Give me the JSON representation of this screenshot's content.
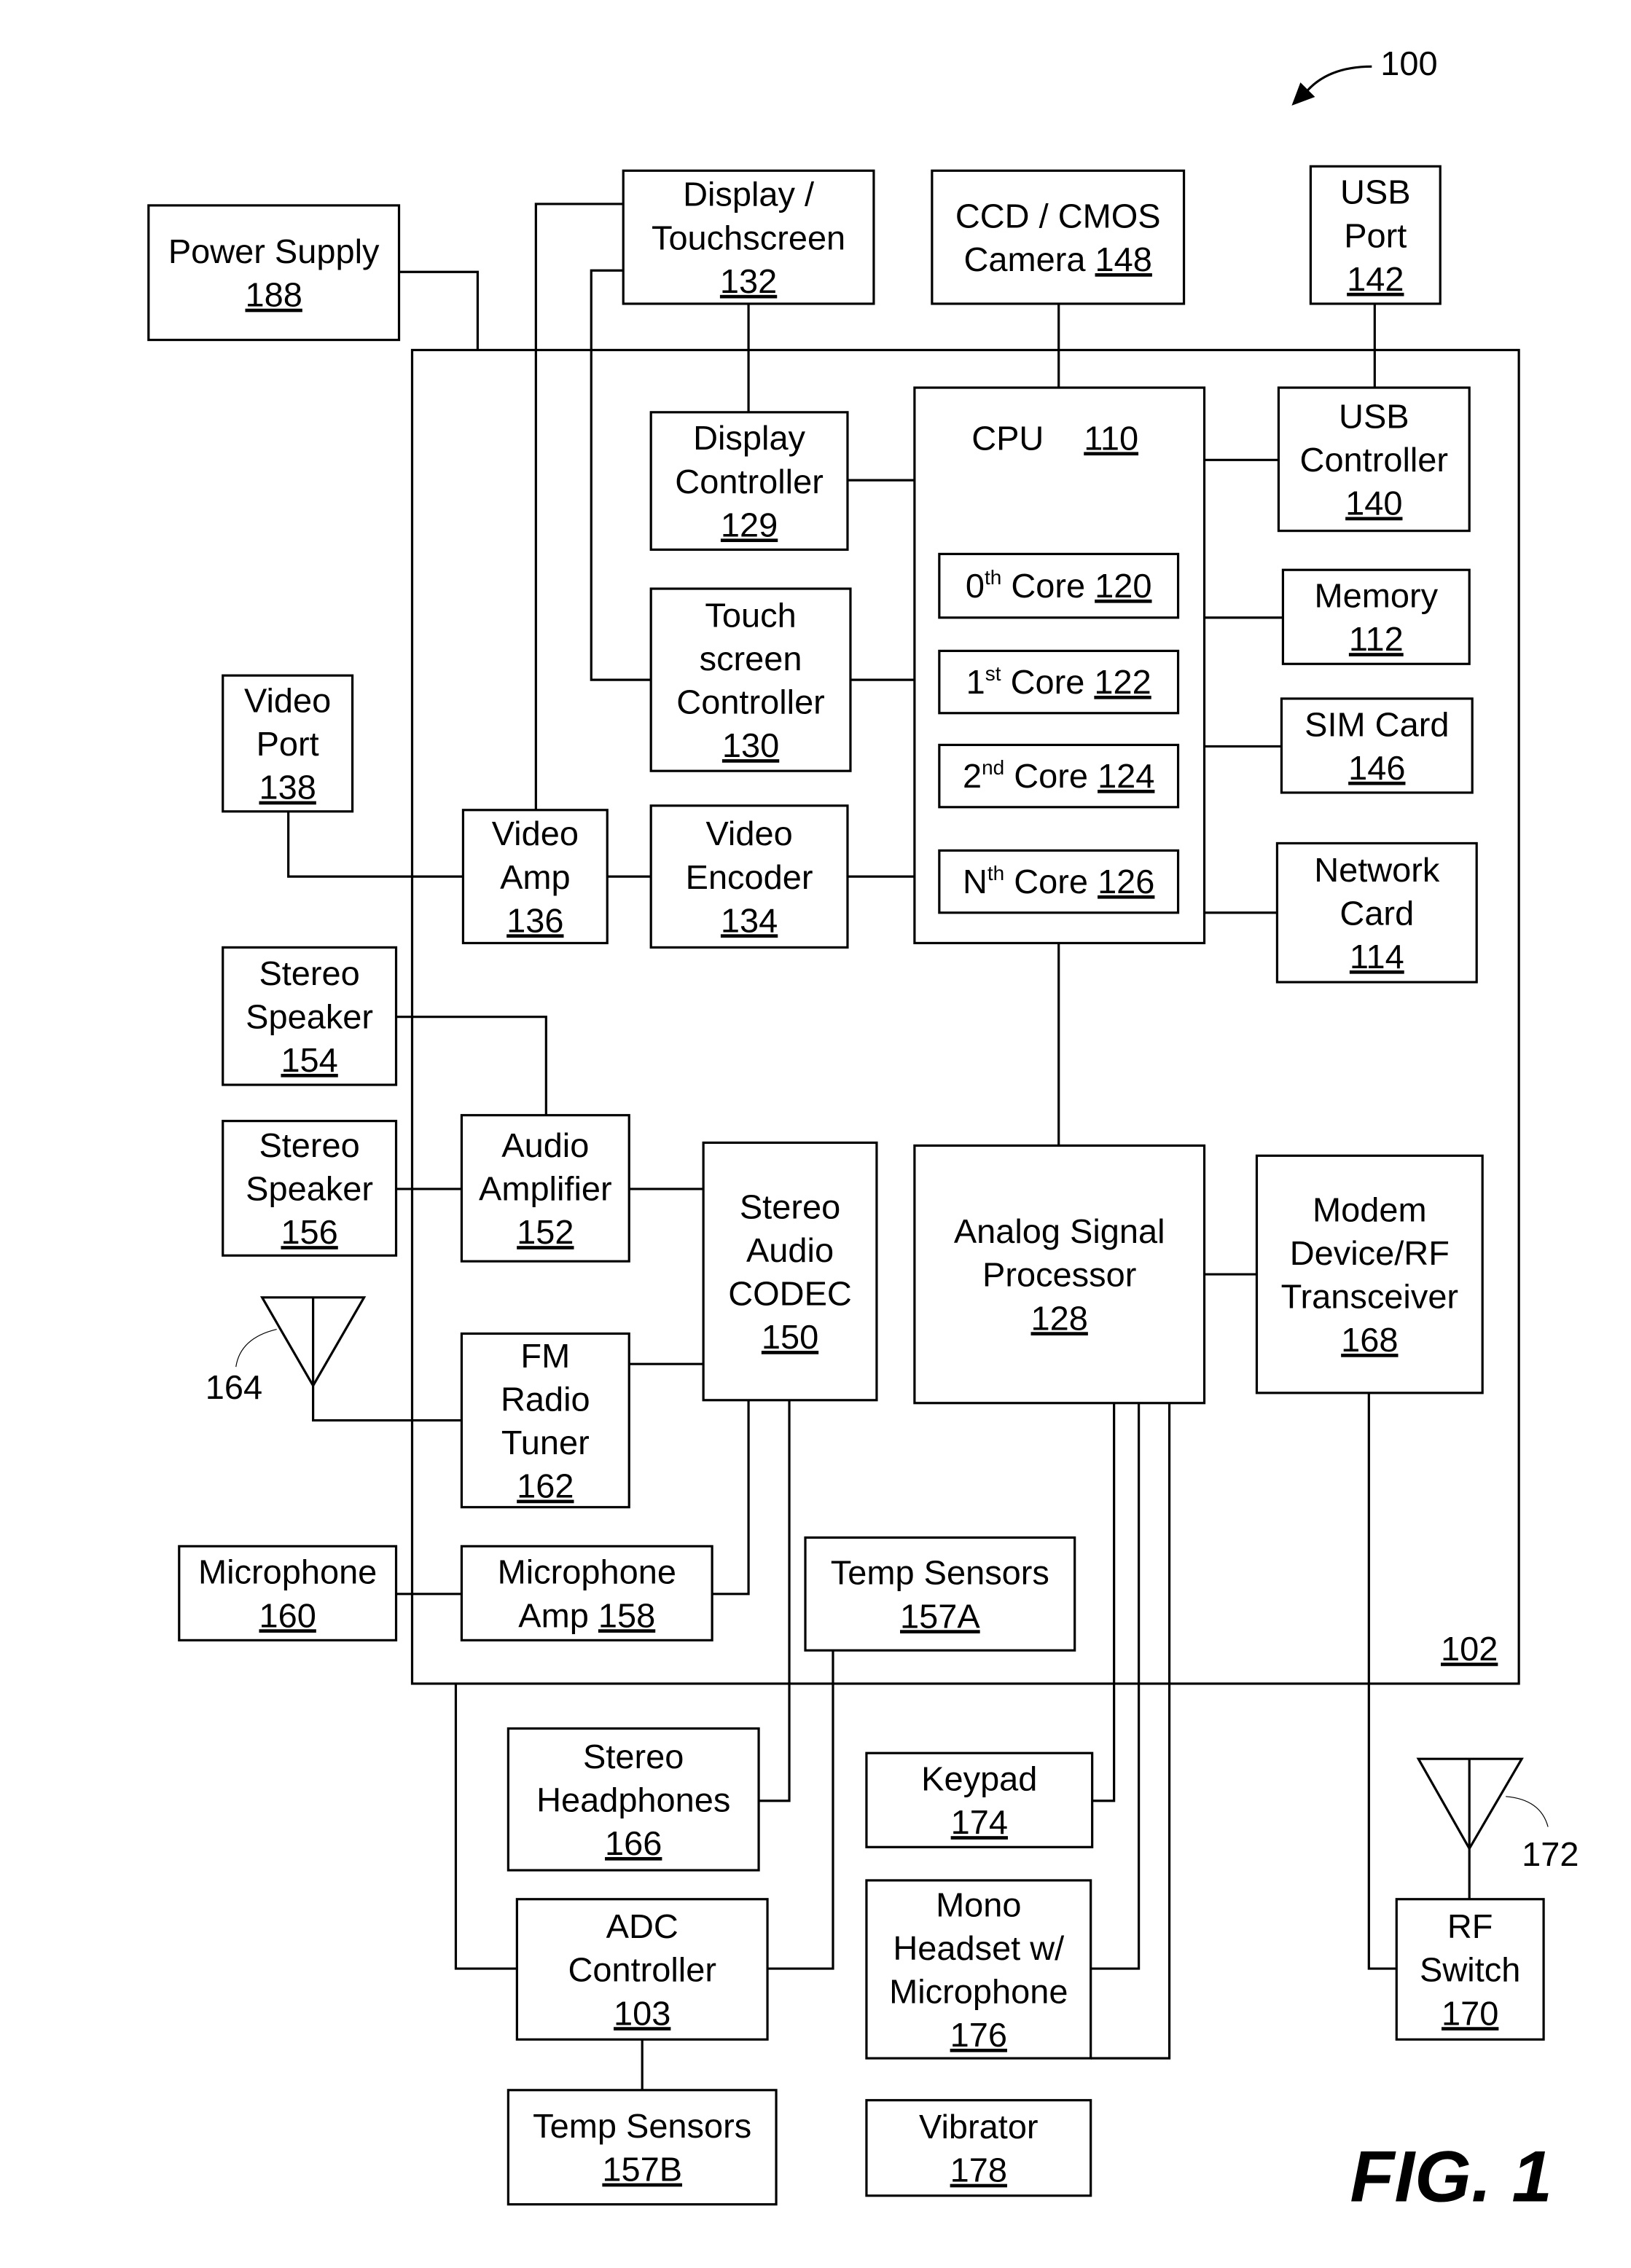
{
  "figure": {
    "label": "FIG.  1",
    "system_ref": "100",
    "chip_ref": "102"
  },
  "blocks": [
    {
      "id": "power-supply",
      "lines": [
        "Power Supply"
      ],
      "ref": "188"
    },
    {
      "id": "display-touchscreen",
      "lines": [
        "Display /",
        "Touchscreen"
      ],
      "ref": "132"
    },
    {
      "id": "camera",
      "lines": [
        "CCD / CMOS"
      ],
      "inline_prefix": "Camera",
      "ref": "148"
    },
    {
      "id": "usb-port",
      "lines": [
        "USB",
        "Port"
      ],
      "ref": "142"
    },
    {
      "id": "display-controller",
      "lines": [
        "Display",
        "Controller"
      ],
      "ref": "129"
    },
    {
      "id": "cpu",
      "inline_prefix": "CPU",
      "ref": "110"
    },
    {
      "id": "usb-controller",
      "lines": [
        "USB",
        "Controller"
      ],
      "ref": "140"
    },
    {
      "id": "core-0",
      "base": "0",
      "sup": "th",
      "suffix": "Core",
      "ref": "120"
    },
    {
      "id": "core-1",
      "base": "1",
      "sup": "st",
      "suffix": "Core",
      "ref": "122"
    },
    {
      "id": "core-2",
      "base": "2",
      "sup": "nd",
      "suffix": "Core",
      "ref": "124"
    },
    {
      "id": "core-n",
      "base": "N",
      "sup": "th",
      "suffix": "Core",
      "ref": "126"
    },
    {
      "id": "memory",
      "lines": [
        "Memory"
      ],
      "ref": "112"
    },
    {
      "id": "sim-card",
      "lines": [
        "SIM Card"
      ],
      "ref": "146"
    },
    {
      "id": "touchscreen-controller",
      "lines": [
        "Touch",
        "screen",
        "Controller"
      ],
      "ref": "130"
    },
    {
      "id": "network-card",
      "lines": [
        "Network",
        "Card"
      ],
      "ref": "114"
    },
    {
      "id": "video-port",
      "lines": [
        "Video",
        "Port"
      ],
      "ref": "138"
    },
    {
      "id": "video-amp",
      "lines": [
        "Video",
        "Amp"
      ],
      "ref": "136"
    },
    {
      "id": "video-encoder",
      "lines": [
        "Video",
        "Encoder"
      ],
      "ref": "134"
    },
    {
      "id": "stereo-speaker-154",
      "lines": [
        "Stereo",
        "Speaker"
      ],
      "ref": "154"
    },
    {
      "id": "stereo-speaker-156",
      "lines": [
        "Stereo",
        "Speaker"
      ],
      "ref": "156"
    },
    {
      "id": "audio-amplifier",
      "lines": [
        "Audio",
        "Amplifier"
      ],
      "ref": "152"
    },
    {
      "id": "stereo-audio-codec",
      "lines": [
        "Stereo",
        "Audio",
        "CODEC"
      ],
      "ref": "150"
    },
    {
      "id": "analog-signal-processor",
      "lines": [
        "Analog Signal",
        "Processor"
      ],
      "ref": "128"
    },
    {
      "id": "modem-rf-transceiver",
      "lines": [
        "Modem",
        "Device/RF",
        "Transceiver"
      ],
      "ref": "168"
    },
    {
      "id": "fm-radio-tuner",
      "lines": [
        "FM",
        "Radio",
        "Tuner"
      ],
      "ref": "162"
    },
    {
      "id": "microphone",
      "lines": [
        "Microphone"
      ],
      "ref": "160"
    },
    {
      "id": "microphone-amp",
      "lines": [
        "Microphone"
      ],
      "inline_prefix": "Amp",
      "ref": "158"
    },
    {
      "id": "temp-sensors-157a",
      "lines": [
        "Temp Sensors"
      ],
      "ref": "157A"
    },
    {
      "id": "stereo-headphones",
      "lines": [
        "Stereo",
        "Headphones"
      ],
      "ref": "166"
    },
    {
      "id": "keypad",
      "lines": [
        "Keypad"
      ],
      "ref": "174"
    },
    {
      "id": "adc-controller",
      "lines": [
        "ADC",
        "Controller"
      ],
      "ref": "103"
    },
    {
      "id": "mono-headset",
      "lines": [
        "Mono",
        "Headset w/",
        "Microphone"
      ],
      "ref": "176"
    },
    {
      "id": "rf-switch",
      "lines": [
        "RF",
        "Switch"
      ],
      "ref": "170"
    },
    {
      "id": "temp-sensors-157b",
      "lines": [
        "Temp Sensors"
      ],
      "ref": "157B"
    },
    {
      "id": "vibrator",
      "lines": [
        "Vibrator"
      ],
      "ref": "178"
    }
  ],
  "antennas": [
    {
      "id": "antenna-164",
      "ref": "164"
    },
    {
      "id": "antenna-172",
      "ref": "172"
    }
  ]
}
